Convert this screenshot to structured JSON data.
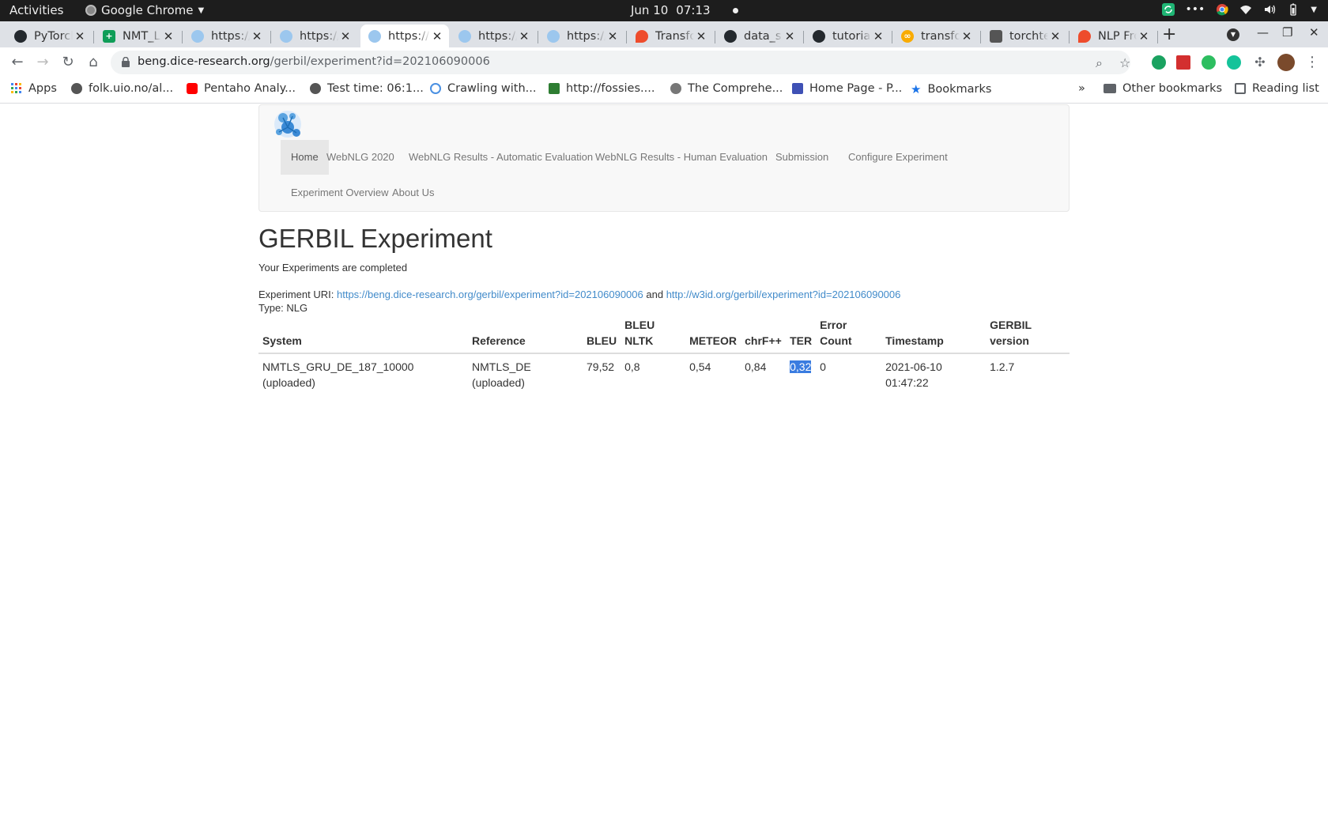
{
  "topbar": {
    "activities": "Activities",
    "app_name": "Google Chrome",
    "date": "Jun 10",
    "time": "07:13"
  },
  "tabs": [
    {
      "title": "PyTorch",
      "favicon": "github-icon",
      "active": false
    },
    {
      "title": "NMT_L",
      "favicon": "sheets-icon",
      "active": false
    },
    {
      "title": "https://",
      "favicon": "gerbil-icon",
      "active": false
    },
    {
      "title": "https://",
      "favicon": "gerbil-icon",
      "active": false
    },
    {
      "title": "https://",
      "favicon": "gerbil-icon",
      "active": true
    },
    {
      "title": "https://",
      "favicon": "gerbil-icon",
      "active": false
    },
    {
      "title": "https://",
      "favicon": "gerbil-icon",
      "active": false
    },
    {
      "title": "Transformer",
      "favicon": "pytorch-icon",
      "active": false
    },
    {
      "title": "data_s",
      "favicon": "github-icon",
      "active": false
    },
    {
      "title": "tutorial",
      "favicon": "github-icon",
      "active": false
    },
    {
      "title": "transformer",
      "favicon": "colab-icon",
      "active": false
    },
    {
      "title": "torchtext",
      "favicon": "docs-icon",
      "active": false
    },
    {
      "title": "NLP From",
      "favicon": "pytorch-icon",
      "active": false
    }
  ],
  "address_bar": {
    "domain": "beng.dice-research.org",
    "path": "/gerbil/experiment?id=202106090006"
  },
  "bookmarks": [
    {
      "label": "Apps",
      "icon": "apps-grid-icon"
    },
    {
      "label": "folk.uio.no/al...",
      "icon": "globe-icon"
    },
    {
      "label": "Pentaho Analy...",
      "icon": "youtube-icon"
    },
    {
      "label": "Test time: 06:1...",
      "icon": "globe-icon"
    },
    {
      "label": "Crawling with...",
      "icon": "spiral-icon"
    },
    {
      "label": "http://fossies....",
      "icon": "fresh-icon"
    },
    {
      "label": "The Comprehe...",
      "icon": "r-icon"
    },
    {
      "label": "Home Page - P...",
      "icon": "pq-icon"
    },
    {
      "label": "Bookmarks",
      "icon": "star-icon"
    }
  ],
  "bookmarks_right": {
    "other": "Other bookmarks",
    "reading": "Reading list"
  },
  "site_nav": [
    {
      "label": "Home",
      "active": true
    },
    {
      "label": "WebNLG 2020",
      "active": false
    },
    {
      "label": "WebNLG Results - Automatic Evaluation",
      "active": false
    },
    {
      "label": "WebNLG Results - Human Evaluation",
      "active": false
    },
    {
      "label": "Submission",
      "active": false
    },
    {
      "label": "Configure Experiment",
      "active": false
    },
    {
      "label": "Experiment Overview",
      "active": false
    },
    {
      "label": "About Us",
      "active": false
    }
  ],
  "experiment": {
    "title": "GERBIL Experiment",
    "status": "Your Experiments are completed",
    "uri_label": "Experiment URI:",
    "uri_1": "https://beng.dice-research.org/gerbil/experiment?id=202106090006",
    "uri_joiner": "and",
    "uri_2": "http://w3id.org/gerbil/experiment?id=202106090006",
    "type_line": "Type: NLG"
  },
  "results_table": {
    "headers": [
      "System",
      "Reference",
      "BLEU",
      "BLEU NLTK",
      "METEOR",
      "chrF++",
      "TER",
      "Error Count",
      "Timestamp",
      "GERBIL version"
    ],
    "header_lines": [
      [
        "System"
      ],
      [
        "Reference"
      ],
      [
        "BLEU"
      ],
      [
        "BLEU",
        "NLTK"
      ],
      [
        "METEOR"
      ],
      [
        "chrF++"
      ],
      [
        "TER"
      ],
      [
        "Error",
        "Count"
      ],
      [
        "Timestamp"
      ],
      [
        "GERBIL",
        "version"
      ]
    ],
    "rows": [
      {
        "system": [
          "NMTLS_GRU_DE_187_10000",
          "(uploaded)"
        ],
        "reference": [
          "NMTLS_DE",
          "(uploaded)"
        ],
        "bleu": "79,52",
        "bleu_nltk": "0,8",
        "meteor": "0,54",
        "chrf": "0,84",
        "ter": "0,32",
        "error_count": "0",
        "timestamp": [
          "2021-06-10",
          "01:47:22"
        ],
        "gerbil_version": "1.2.7"
      }
    ]
  },
  "colors": {
    "link": "#428bca",
    "selection": "#3a7ce0",
    "tabstrip": "#dee1e6"
  }
}
